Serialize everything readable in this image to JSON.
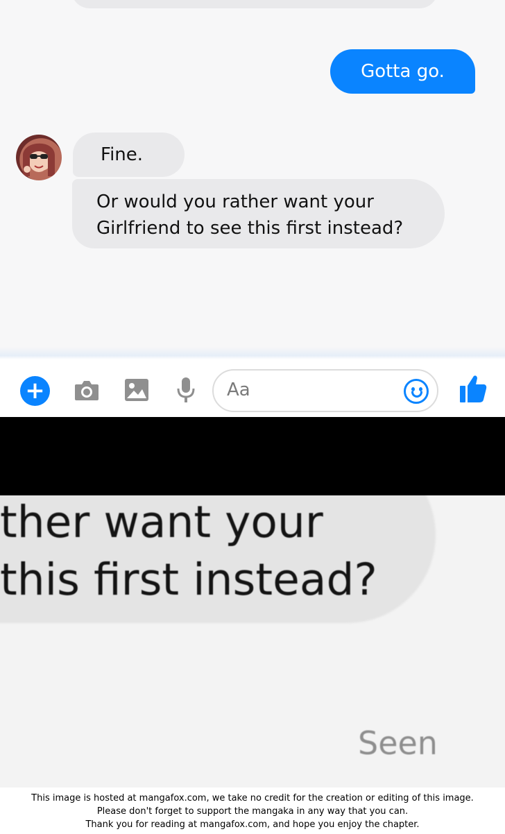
{
  "conversation": {
    "messages": [
      {
        "direction": "sent",
        "text": "Gotta go."
      },
      {
        "direction": "received",
        "text": "Fine."
      },
      {
        "direction": "received",
        "lines": [
          "Or would you rather want your",
          "Girlfriend to see this first instead?"
        ]
      }
    ]
  },
  "composer": {
    "placeholder": "Aa",
    "icons": [
      "plus-icon",
      "camera-icon",
      "image-icon",
      "microphone-icon",
      "smiley-icon",
      "thumbs-up-icon"
    ],
    "accent_color": "#0a84ff",
    "icon_gray": "#909090"
  },
  "zoom_panel": {
    "lines": [
      "ther want your",
      "this first instead?"
    ],
    "status": "Seen"
  },
  "footer": {
    "lines": [
      "This image is hosted at mangafox.com, we take no credit for the creation or editing of this image.",
      "Please don't forget to support the mangaka in any way that you can.",
      "Thank you for reading at mangafox.com, and hope you enjoy the chapter."
    ]
  }
}
